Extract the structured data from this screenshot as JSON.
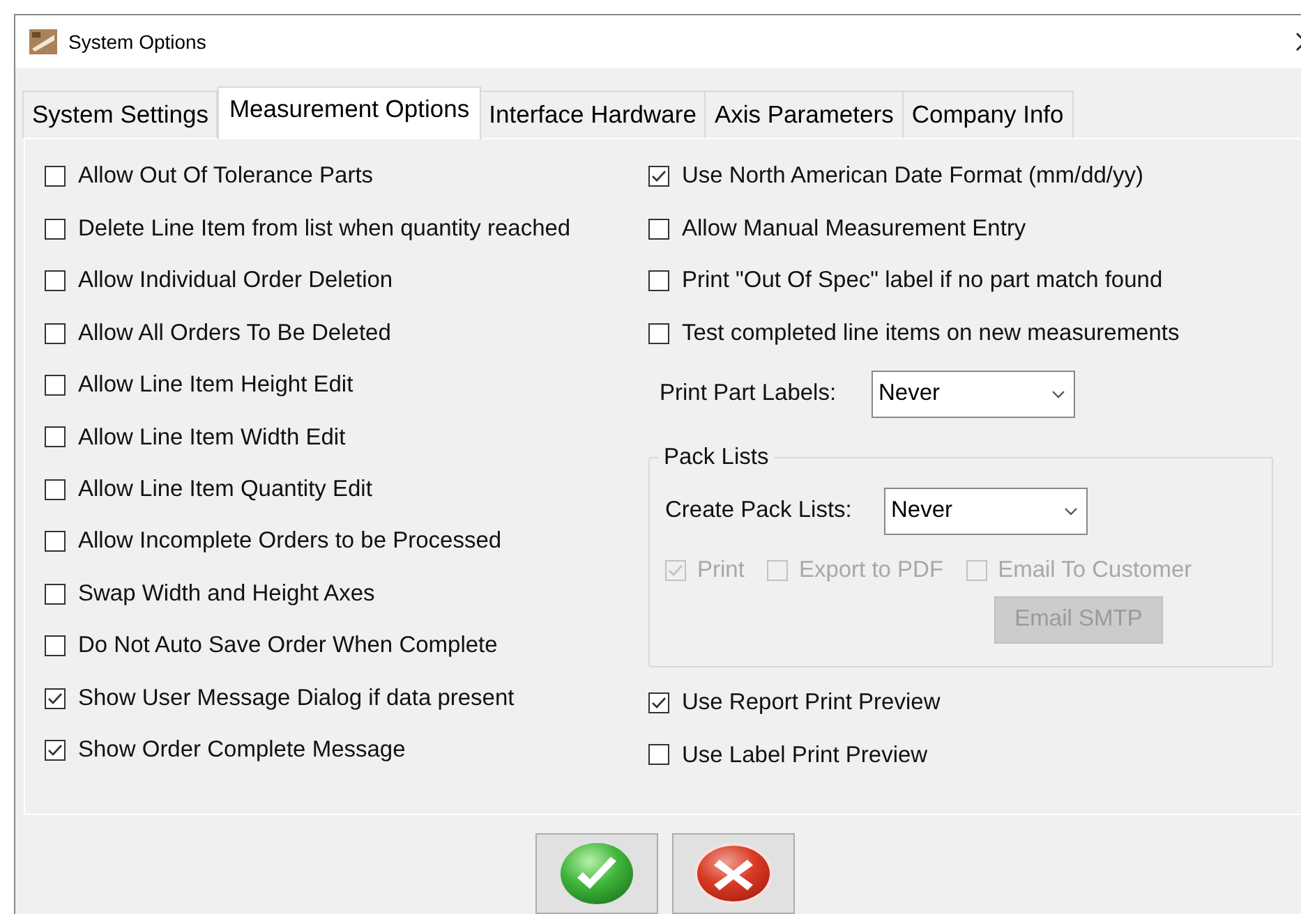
{
  "window": {
    "title": "System Options"
  },
  "tabs": [
    {
      "label": "System Settings",
      "selected": false
    },
    {
      "label": "Measurement Options",
      "selected": true
    },
    {
      "label": "Interface Hardware",
      "selected": false
    },
    {
      "label": "Axis Parameters",
      "selected": false
    },
    {
      "label": "Company Info",
      "selected": false
    }
  ],
  "left_options": [
    {
      "label": "Allow Out Of Tolerance Parts",
      "checked": false
    },
    {
      "label": "Delete Line Item from list when quantity reached",
      "checked": false
    },
    {
      "label": "Allow Individual Order Deletion",
      "checked": false
    },
    {
      "label": "Allow All Orders To Be Deleted",
      "checked": false
    },
    {
      "label": "Allow Line Item Height Edit",
      "checked": false
    },
    {
      "label": "Allow Line Item Width Edit",
      "checked": false
    },
    {
      "label": "Allow Line Item Quantity Edit",
      "checked": false
    },
    {
      "label": "Allow Incomplete Orders to be Processed",
      "checked": false
    },
    {
      "label": "Swap Width and Height Axes",
      "checked": false
    },
    {
      "label": "Do Not Auto Save Order When Complete",
      "checked": false
    },
    {
      "label": "Show User Message Dialog if data present",
      "checked": true
    },
    {
      "label": "Show Order Complete Message",
      "checked": true
    }
  ],
  "right_options": [
    {
      "label": "Use North American Date Format (mm/dd/yy)",
      "checked": true
    },
    {
      "label": "Allow Manual Measurement Entry",
      "checked": false
    },
    {
      "label": "Print \"Out Of Spec\" label if no part match found",
      "checked": false
    },
    {
      "label": "Test completed line items on new measurements",
      "checked": false
    }
  ],
  "print_part_labels": {
    "label": "Print Part Labels:",
    "value": "Never"
  },
  "pack_lists": {
    "title": "Pack Lists",
    "label": "Create Pack Lists:",
    "value": "Never",
    "options": [
      {
        "label": "Print",
        "checked": true,
        "disabled": true
      },
      {
        "label": "Export to PDF",
        "checked": false,
        "disabled": true
      },
      {
        "label": "Email To Customer",
        "checked": false,
        "disabled": true
      }
    ],
    "email_button": {
      "label": "Email SMTP",
      "disabled": true
    }
  },
  "preview_options": [
    {
      "label": "Use Report Print Preview",
      "checked": true
    },
    {
      "label": "Use Label Print Preview",
      "checked": false
    }
  ]
}
